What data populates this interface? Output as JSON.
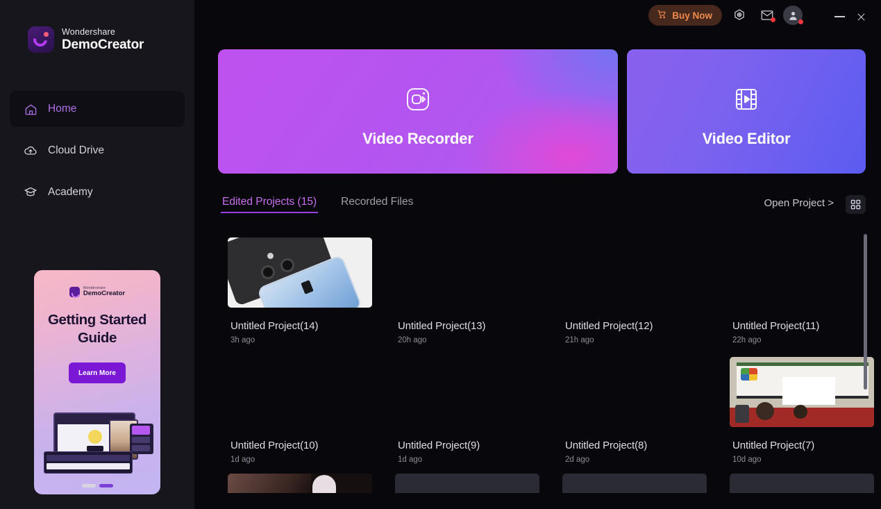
{
  "app": {
    "brand_top": "Wondershare",
    "brand_name": "DemoCreator"
  },
  "sidebar": {
    "items": [
      {
        "label": "Home",
        "icon": "home-icon",
        "active": true
      },
      {
        "label": "Cloud Drive",
        "icon": "cloud-icon",
        "active": false
      },
      {
        "label": "Academy",
        "icon": "graduation-cap-icon",
        "active": false
      }
    ],
    "promo": {
      "logo_top": "Wondershare",
      "logo_name": "DemoCreator",
      "title": "Getting Started Guide",
      "cta": "Learn More"
    }
  },
  "titlebar": {
    "buy_now": "Buy Now",
    "icons": [
      {
        "name": "settings-icon",
        "badge": false
      },
      {
        "name": "mail-icon",
        "badge": true
      },
      {
        "name": "account-icon",
        "badge": true
      }
    ],
    "minimize": "—",
    "close": "×"
  },
  "hero": {
    "recorder": {
      "label": "Video Recorder",
      "icon": "camera-recorder-icon",
      "accent": "#bf52ef"
    },
    "editor": {
      "label": "Video Editor",
      "icon": "film-play-icon",
      "accent": "#5b5cf0"
    }
  },
  "toolbar": {
    "tabs": [
      {
        "label": "Edited Projects (15)",
        "active": true
      },
      {
        "label": "Recorded Files",
        "active": false
      }
    ],
    "open_project": "Open Project >",
    "grid_view_icon": "grid-view-icon"
  },
  "projects": [
    {
      "name": "Untitled Project(14)",
      "time": "3h ago",
      "thumb": "phone"
    },
    {
      "name": "Untitled Project(13)",
      "time": "20h ago",
      "thumb": "none"
    },
    {
      "name": "Untitled Project(12)",
      "time": "21h ago",
      "thumb": "none"
    },
    {
      "name": "Untitled Project(11)",
      "time": "22h ago",
      "thumb": "none"
    },
    {
      "name": "Untitled Project(10)",
      "time": "1d ago",
      "thumb": "none"
    },
    {
      "name": "Untitled Project(9)",
      "time": "1d ago",
      "thumb": "none"
    },
    {
      "name": "Untitled Project(8)",
      "time": "2d ago",
      "thumb": "none"
    },
    {
      "name": "Untitled Project(7)",
      "time": "10d ago",
      "thumb": "classroom"
    }
  ],
  "colors": {
    "background": "#08080c",
    "sidebar": "#16161c",
    "accent_purple": "#b071e8",
    "tab_underline": "#9b3fe0",
    "buy_now_bg": "#46281d",
    "buy_now_text": "#f08a4c",
    "badge_red": "#f0373c"
  }
}
